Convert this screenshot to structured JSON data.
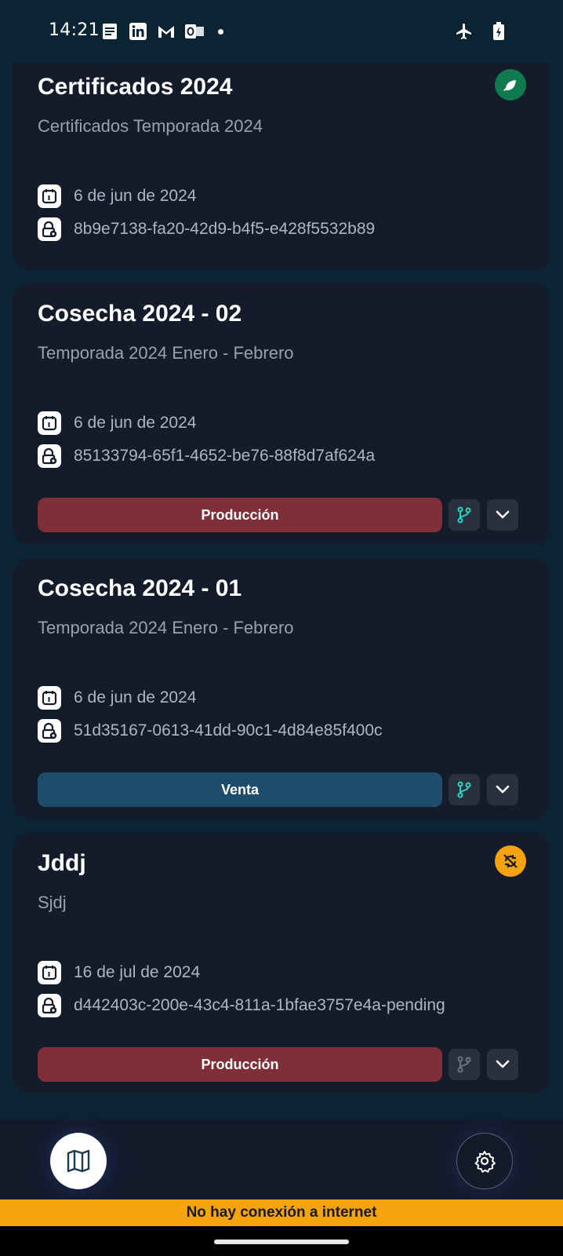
{
  "status_bar": {
    "time": "14:21",
    "left_icons": [
      "notes-icon",
      "linkedin-icon",
      "gmail-icon",
      "outlook-icon",
      "notification-dot"
    ],
    "right_icons": [
      "airplane-mode-icon",
      "battery-charging-icon"
    ]
  },
  "cards": [
    {
      "title": "Certificados 2024",
      "subtitle": "Certificados Temporada 2024",
      "date": "6 de jun de 2024",
      "id": "8b9e7138-fa20-42d9-b4f5-e428f5532b89",
      "badge": {
        "icon": "leaf-icon",
        "color": "#0f7a4f"
      }
    },
    {
      "title": "Cosecha 2024 - 02",
      "subtitle": "Temporada 2024 Enero - Febrero",
      "date": "6 de jun de 2024",
      "id": "85133794-65f1-4652-be76-88f8d7af624a",
      "action": {
        "label": "Producción",
        "color": "#7f2f37"
      }
    },
    {
      "title": "Cosecha 2024 - 01",
      "subtitle": "Temporada 2024 Enero - Febrero",
      "date": "6 de jun de 2024",
      "id": "51d35167-0613-41dd-90c1-4d84e85f400c",
      "action": {
        "label": "Venta",
        "color": "#1e4d6b"
      }
    },
    {
      "title": "Jddj",
      "subtitle": "Sjdj",
      "date": "16 de jul de 2024",
      "id": "d442403c-200e-43c4-811a-1bfae3757e4a-pending",
      "badge": {
        "icon": "sync-off-icon",
        "color": "#f5a30f"
      },
      "action": {
        "label": "Producción",
        "color": "#7f2f37"
      }
    }
  ],
  "bottom_nav": {
    "map_icon": "map-icon",
    "settings_icon": "gear-icon"
  },
  "offline_banner": "No hay conexión a internet",
  "colors": {
    "background": "#0b2433",
    "card": "#141b2a",
    "accent_teal": "#2fd1c0",
    "warning": "#f5a30f"
  }
}
